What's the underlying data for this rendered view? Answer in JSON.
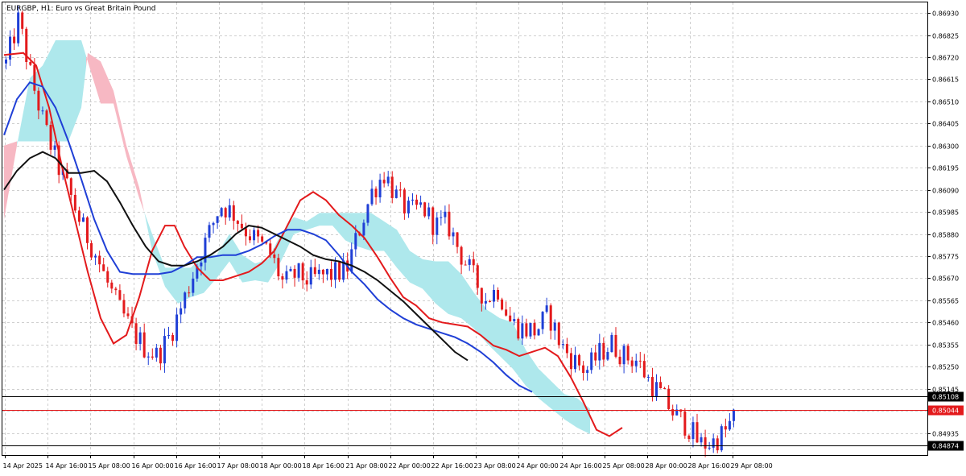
{
  "chart_data": {
    "type": "candlestick",
    "title": "EURGBP, H1:  Euro vs Great Britain Pound",
    "ylim": [
      0.8483,
      0.8698
    ],
    "y_ticks": [
      "0.86930",
      "0.86825",
      "0.86720",
      "0.86615",
      "0.86510",
      "0.86405",
      "0.86300",
      "0.86195",
      "0.86090",
      "0.85985",
      "0.85880",
      "0.85775",
      "0.85670",
      "0.85565",
      "0.85460",
      "0.85355",
      "0.85250",
      "0.85145",
      "0.85040",
      "0.84935"
    ],
    "x_ticks": [
      "14 Apr 2025",
      "14 Apr 16:00",
      "15 Apr 08:00",
      "16 Apr 00:00",
      "16 Apr 16:00",
      "17 Apr 08:00",
      "18 Apr 00:00",
      "18 Apr 16:00",
      "21 Apr 08:00",
      "22 Apr 00:00",
      "22 Apr 16:00",
      "23 Apr 08:00",
      "24 Apr 00:00",
      "24 Apr 16:00",
      "25 Apr 08:00",
      "28 Apr 00:00",
      "28 Apr 16:00",
      "29 Apr 08:00"
    ],
    "bars_total": 180,
    "close_anchors": [
      [
        0,
        0.8669
      ],
      [
        4,
        0.869
      ],
      [
        8,
        0.8662
      ],
      [
        12,
        0.864
      ],
      [
        16,
        0.8622
      ],
      [
        20,
        0.8608
      ],
      [
        24,
        0.8592
      ],
      [
        28,
        0.858
      ],
      [
        32,
        0.8565
      ],
      [
        36,
        0.8552
      ],
      [
        40,
        0.8542
      ],
      [
        44,
        0.8534
      ],
      [
        48,
        0.853
      ],
      [
        52,
        0.854
      ],
      [
        56,
        0.8555
      ],
      [
        60,
        0.8572
      ],
      [
        64,
        0.8587
      ],
      [
        68,
        0.8602
      ],
      [
        72,
        0.8598
      ],
      [
        76,
        0.859
      ],
      [
        80,
        0.8584
      ],
      [
        84,
        0.8578
      ],
      [
        88,
        0.8564
      ],
      [
        92,
        0.8569
      ],
      [
        96,
        0.8566
      ],
      [
        100,
        0.8568
      ],
      [
        104,
        0.8569
      ],
      [
        108,
        0.8571
      ],
      [
        112,
        0.859
      ],
      [
        116,
        0.8608
      ],
      [
        120,
        0.8617
      ],
      [
        124,
        0.8605
      ],
      [
        128,
        0.8598
      ],
      [
        132,
        0.8601
      ],
      [
        136,
        0.8592
      ],
      [
        140,
        0.8593
      ],
      [
        144,
        0.8579
      ],
      [
        148,
        0.8568
      ],
      [
        152,
        0.8557
      ],
      [
        156,
        0.8562
      ],
      [
        160,
        0.8546
      ],
      [
        164,
        0.8543
      ],
      [
        168,
        0.8542
      ],
      [
        172,
        0.855
      ],
      [
        176,
        0.8535
      ],
      [
        180,
        0.8528
      ],
      [
        184,
        0.8523
      ],
      [
        188,
        0.8531
      ],
      [
        192,
        0.8536
      ],
      [
        196,
        0.853
      ],
      [
        200,
        0.8528
      ],
      [
        204,
        0.8518
      ],
      [
        208,
        0.8511
      ],
      [
        212,
        0.8502
      ],
      [
        216,
        0.8497
      ],
      [
        220,
        0.8488
      ],
      [
        224,
        0.8489
      ],
      [
        228,
        0.8494
      ],
      [
        232,
        0.8504
      ]
    ],
    "series": [
      {
        "role": "fast_ma",
        "color": "#e31a1c",
        "values": [
          [
            0,
            0.8673
          ],
          [
            6,
            0.8674
          ],
          [
            10,
            0.8668
          ],
          [
            14,
            0.8648
          ],
          [
            18,
            0.862
          ],
          [
            22,
            0.8595
          ],
          [
            26,
            0.857
          ],
          [
            30,
            0.8548
          ],
          [
            34,
            0.8536
          ],
          [
            38,
            0.854
          ],
          [
            42,
            0.8558
          ],
          [
            46,
            0.858
          ],
          [
            50,
            0.8592
          ],
          [
            53,
            0.8592
          ],
          [
            56,
            0.8582
          ],
          [
            60,
            0.8572
          ],
          [
            64,
            0.8566
          ],
          [
            68,
            0.8566
          ],
          [
            72,
            0.8568
          ],
          [
            76,
            0.857
          ],
          [
            80,
            0.8574
          ],
          [
            84,
            0.858
          ],
          [
            88,
            0.8592
          ],
          [
            92,
            0.8604
          ],
          [
            96,
            0.8608
          ],
          [
            100,
            0.8604
          ],
          [
            104,
            0.8597
          ],
          [
            108,
            0.8592
          ],
          [
            112,
            0.8586
          ],
          [
            116,
            0.8577
          ],
          [
            120,
            0.8567
          ],
          [
            124,
            0.8558
          ],
          [
            128,
            0.8554
          ],
          [
            132,
            0.8548
          ],
          [
            136,
            0.8546
          ],
          [
            140,
            0.8545
          ],
          [
            144,
            0.8544
          ],
          [
            148,
            0.854
          ],
          [
            152,
            0.8535
          ],
          [
            156,
            0.8533
          ],
          [
            160,
            0.853
          ],
          [
            164,
            0.8532
          ],
          [
            168,
            0.8534
          ],
          [
            172,
            0.853
          ],
          [
            176,
            0.852
          ],
          [
            180,
            0.8508
          ],
          [
            184,
            0.8495
          ],
          [
            188,
            0.8492
          ],
          [
            192,
            0.8496
          ]
        ]
      },
      {
        "role": "mid_ma",
        "color": "#1f3fd6",
        "values": [
          [
            0,
            0.8635
          ],
          [
            4,
            0.8652
          ],
          [
            8,
            0.866
          ],
          [
            12,
            0.8658
          ],
          [
            16,
            0.8648
          ],
          [
            20,
            0.8632
          ],
          [
            24,
            0.8614
          ],
          [
            28,
            0.8595
          ],
          [
            32,
            0.858
          ],
          [
            36,
            0.857
          ],
          [
            40,
            0.8569
          ],
          [
            44,
            0.8569
          ],
          [
            48,
            0.8569
          ],
          [
            52,
            0.857
          ],
          [
            56,
            0.8573
          ],
          [
            60,
            0.8577
          ],
          [
            64,
            0.8577
          ],
          [
            68,
            0.8578
          ],
          [
            72,
            0.8578
          ],
          [
            76,
            0.858
          ],
          [
            80,
            0.8583
          ],
          [
            84,
            0.8587
          ],
          [
            88,
            0.859
          ],
          [
            92,
            0.859
          ],
          [
            96,
            0.8588
          ],
          [
            100,
            0.8585
          ],
          [
            104,
            0.8578
          ],
          [
            108,
            0.857
          ],
          [
            112,
            0.8564
          ],
          [
            116,
            0.8557
          ],
          [
            120,
            0.8552
          ],
          [
            124,
            0.8548
          ],
          [
            128,
            0.8545
          ],
          [
            132,
            0.8543
          ],
          [
            136,
            0.8541
          ],
          [
            140,
            0.8539
          ],
          [
            144,
            0.8536
          ],
          [
            148,
            0.8532
          ],
          [
            152,
            0.8527
          ],
          [
            156,
            0.8521
          ],
          [
            160,
            0.8516
          ],
          [
            164,
            0.8513
          ]
        ]
      },
      {
        "role": "slow_ma",
        "color": "#111111",
        "values": [
          [
            0,
            0.8609
          ],
          [
            4,
            0.8618
          ],
          [
            8,
            0.8624
          ],
          [
            12,
            0.8627
          ],
          [
            16,
            0.8624
          ],
          [
            20,
            0.8617
          ],
          [
            24,
            0.8617
          ],
          [
            28,
            0.8618
          ],
          [
            32,
            0.8613
          ],
          [
            36,
            0.8603
          ],
          [
            40,
            0.8592
          ],
          [
            44,
            0.8582
          ],
          [
            48,
            0.8575
          ],
          [
            52,
            0.8573
          ],
          [
            56,
            0.8573
          ],
          [
            60,
            0.8575
          ],
          [
            64,
            0.8578
          ],
          [
            68,
            0.8582
          ],
          [
            72,
            0.8588
          ],
          [
            76,
            0.8592
          ],
          [
            80,
            0.8591
          ],
          [
            84,
            0.8588
          ],
          [
            88,
            0.8585
          ],
          [
            92,
            0.8582
          ],
          [
            96,
            0.8578
          ],
          [
            100,
            0.8576
          ],
          [
            104,
            0.8575
          ],
          [
            108,
            0.8573
          ],
          [
            112,
            0.857
          ],
          [
            116,
            0.8566
          ],
          [
            120,
            0.8561
          ],
          [
            124,
            0.8556
          ],
          [
            128,
            0.855
          ],
          [
            132,
            0.8544
          ],
          [
            136,
            0.8538
          ],
          [
            140,
            0.8532
          ],
          [
            144,
            0.8528
          ]
        ]
      }
    ],
    "cloud": {
      "senkou_a": [
        [
          0,
          0.8595
        ],
        [
          4,
          0.863
        ],
        [
          8,
          0.8662
        ],
        [
          12,
          0.8668
        ],
        [
          16,
          0.868
        ],
        [
          20,
          0.868
        ],
        [
          24,
          0.868
        ],
        [
          26,
          0.867
        ],
        [
          30,
          0.865
        ],
        [
          34,
          0.865
        ],
        [
          38,
          0.8625
        ],
        [
          42,
          0.8605
        ],
        [
          46,
          0.8588
        ],
        [
          50,
          0.8572
        ],
        [
          54,
          0.8572
        ],
        [
          58,
          0.8572
        ],
        [
          62,
          0.8578
        ],
        [
          66,
          0.8578
        ],
        [
          70,
          0.8588
        ],
        [
          74,
          0.8578
        ],
        [
          78,
          0.8574
        ],
        [
          82,
          0.8576
        ],
        [
          86,
          0.8588
        ],
        [
          90,
          0.8596
        ],
        [
          94,
          0.8594
        ],
        [
          98,
          0.8598
        ],
        [
          102,
          0.8598
        ],
        [
          106,
          0.8598
        ],
        [
          110,
          0.8598
        ],
        [
          114,
          0.8598
        ],
        [
          118,
          0.8594
        ],
        [
          122,
          0.859
        ],
        [
          126,
          0.858
        ],
        [
          130,
          0.8576
        ],
        [
          134,
          0.8575
        ],
        [
          138,
          0.8575
        ],
        [
          142,
          0.8569
        ],
        [
          146,
          0.856
        ],
        [
          150,
          0.8552
        ],
        [
          154,
          0.8548
        ],
        [
          158,
          0.8546
        ],
        [
          162,
          0.8533
        ],
        [
          166,
          0.8524
        ],
        [
          170,
          0.8518
        ],
        [
          174,
          0.8512
        ],
        [
          178,
          0.851
        ],
        [
          182,
          0.8505
        ]
      ],
      "senkou_b": [
        [
          0,
          0.863
        ],
        [
          4,
          0.8632
        ],
        [
          8,
          0.8632
        ],
        [
          12,
          0.8632
        ],
        [
          16,
          0.8632
        ],
        [
          20,
          0.8632
        ],
        [
          24,
          0.8648
        ],
        [
          26,
          0.8674
        ],
        [
          30,
          0.867
        ],
        [
          34,
          0.8656
        ],
        [
          38,
          0.863
        ],
        [
          42,
          0.861
        ],
        [
          46,
          0.858
        ],
        [
          50,
          0.8563
        ],
        [
          54,
          0.8555
        ],
        [
          58,
          0.8558
        ],
        [
          62,
          0.856
        ],
        [
          66,
          0.8567
        ],
        [
          70,
          0.8575
        ],
        [
          74,
          0.8565
        ],
        [
          78,
          0.8566
        ],
        [
          82,
          0.8565
        ],
        [
          86,
          0.8575
        ],
        [
          90,
          0.8588
        ],
        [
          94,
          0.859
        ],
        [
          98,
          0.8592
        ],
        [
          102,
          0.8592
        ],
        [
          106,
          0.8585
        ],
        [
          110,
          0.8582
        ],
        [
          114,
          0.858
        ],
        [
          118,
          0.858
        ],
        [
          122,
          0.8572
        ],
        [
          126,
          0.8565
        ],
        [
          130,
          0.8562
        ],
        [
          134,
          0.8555
        ],
        [
          138,
          0.855
        ],
        [
          142,
          0.8548
        ],
        [
          146,
          0.8543
        ],
        [
          150,
          0.8536
        ],
        [
          154,
          0.853
        ],
        [
          158,
          0.8524
        ],
        [
          162,
          0.8516
        ],
        [
          166,
          0.851
        ],
        [
          170,
          0.8505
        ],
        [
          174,
          0.85
        ],
        [
          178,
          0.8496
        ],
        [
          182,
          0.8493
        ]
      ],
      "bullish_color": "#aee8ec",
      "bearish_color": "#f7b8c3"
    },
    "price_lines": [
      {
        "value": 0.85108,
        "label": "0.85108",
        "color": "#000000"
      },
      {
        "value": 0.85044,
        "label": "0.85044",
        "color": "#e31a1c"
      },
      {
        "value": 0.84874,
        "label": "0.84874",
        "color": "#000000"
      }
    ],
    "bull_color": "#1f3fd6",
    "bear_color": "#e31a1c",
    "grid": true,
    "grid_color": "#cfcfcf"
  }
}
